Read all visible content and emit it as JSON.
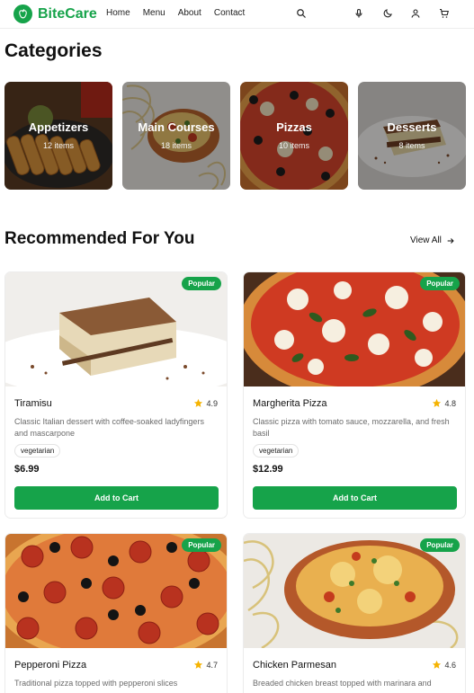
{
  "header": {
    "brand": "BiteCare",
    "nav": [
      "Home",
      "Menu",
      "About",
      "Contact"
    ],
    "icons": [
      "search-icon",
      "mic-icon",
      "theme-moon-icon",
      "user-icon",
      "cart-icon"
    ]
  },
  "colors": {
    "accent": "#16a34a",
    "star": "#f5b301"
  },
  "categories_section": {
    "title": "Categories",
    "items": [
      {
        "name": "Appetizers",
        "count": "12 items"
      },
      {
        "name": "Main Courses",
        "count": "18 items"
      },
      {
        "name": "Pizzas",
        "count": "10 items"
      },
      {
        "name": "Desserts",
        "count": "8 items"
      }
    ]
  },
  "recommended": {
    "title": "Recommended For You",
    "view_all": "View All",
    "cards": [
      {
        "badge": "Popular",
        "name": "Tiramisu",
        "rating": "4.9",
        "description": "Classic Italian dessert with coffee-soaked ladyfingers and mascarpone",
        "tag": "vegetarian",
        "price": "$6.99",
        "button": "Add to Cart"
      },
      {
        "badge": "Popular",
        "name": "Margherita Pizza",
        "rating": "4.8",
        "description": "Classic pizza with tomato sauce, mozzarella, and fresh basil",
        "tag": "vegetarian",
        "price": "$12.99",
        "button": "Add to Cart"
      },
      {
        "badge": "Popular",
        "name": "Pepperoni Pizza",
        "rating": "4.7",
        "description": "Traditional pizza topped with pepperoni slices"
      },
      {
        "badge": "Popular",
        "name": "Chicken Parmesan",
        "rating": "4.6",
        "description": "Breaded chicken breast topped with marinara and"
      }
    ]
  }
}
